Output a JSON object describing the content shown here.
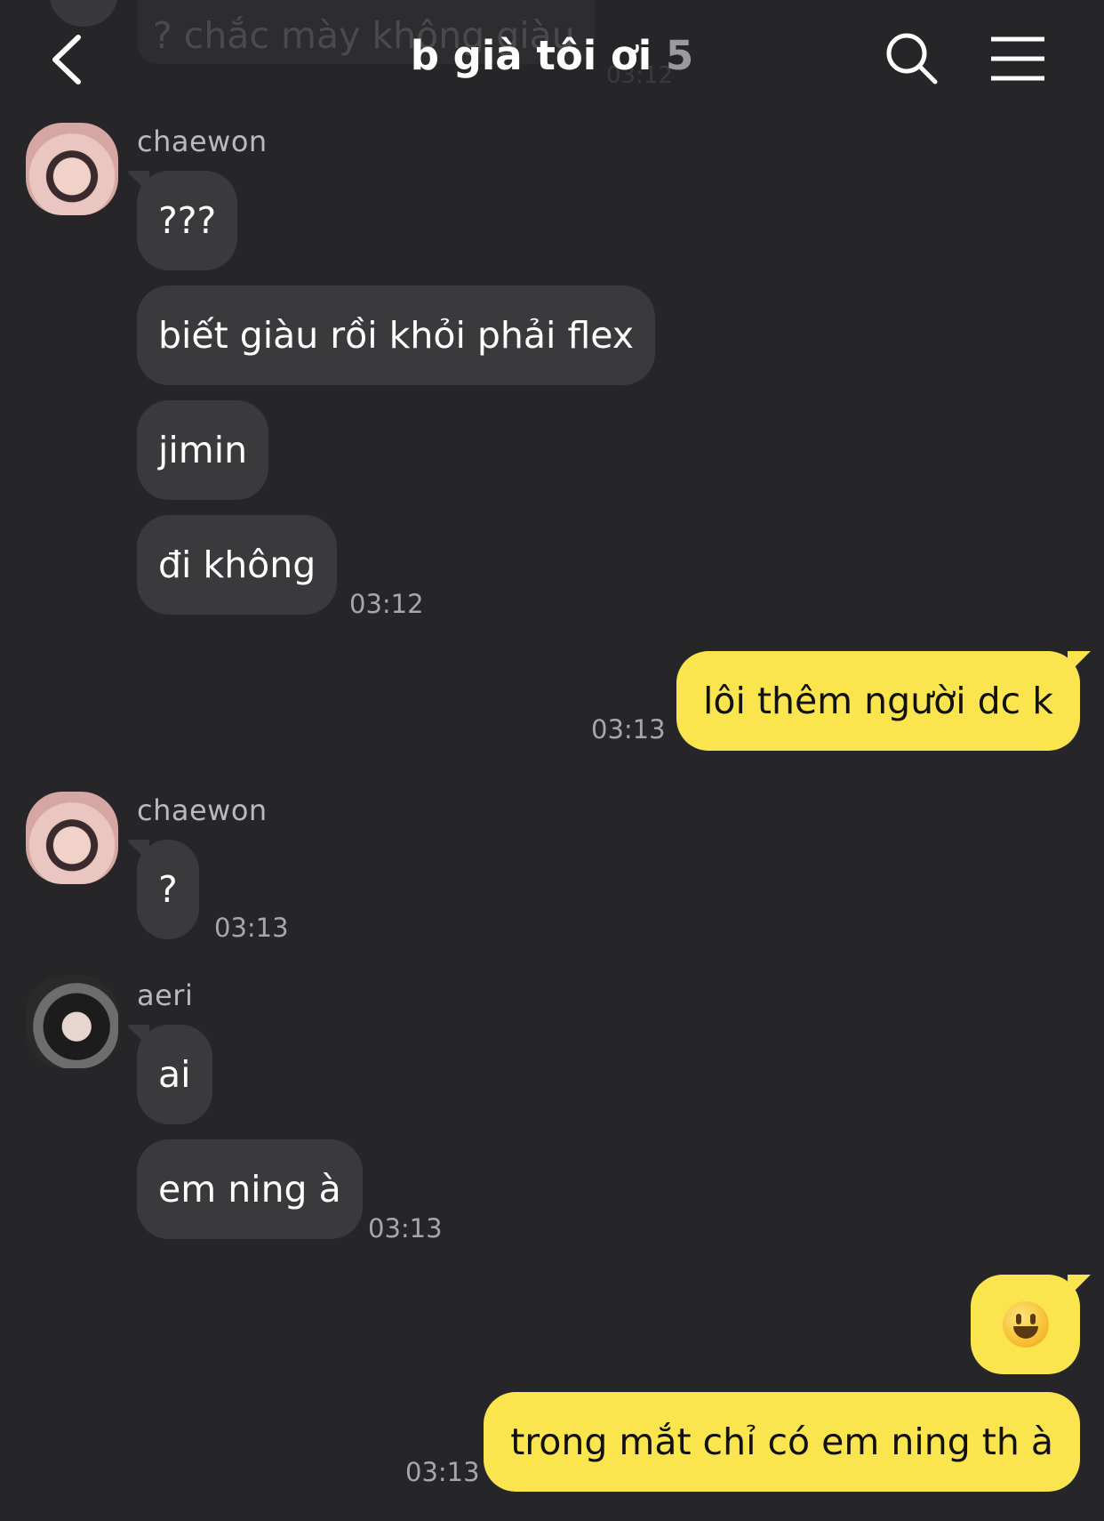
{
  "header": {
    "title": "b già tôi ơi",
    "member_count": "5",
    "background_preview": "? chắc mày không giàu",
    "background_preview_time": "03:12"
  },
  "icons": {
    "back": "chevron-left-icon",
    "search": "search-icon",
    "menu": "hamburger-menu-icon"
  },
  "colors": {
    "background": "#262629",
    "incoming_bubble": "#3a3a3d",
    "outgoing_bubble": "#fbe54f"
  },
  "messages": {
    "g1": {
      "sender": "chaewon",
      "m1": "???",
      "m2": "biết giàu rồi khỏi phải flex",
      "m3": "jimin",
      "m4": "đi không",
      "time": "03:12"
    },
    "me1": {
      "text": "lôi thêm người dc k",
      "time": "03:13"
    },
    "g2": {
      "sender": "chaewon",
      "m1": "?",
      "time": "03:13"
    },
    "g3": {
      "sender": "aeri",
      "m1": "ai",
      "m2": "em ning à",
      "time": "03:13"
    },
    "me2": {
      "emoji": "grinning-face",
      "text": "trong mắt chỉ có em ning th à",
      "time": "03:13"
    }
  }
}
